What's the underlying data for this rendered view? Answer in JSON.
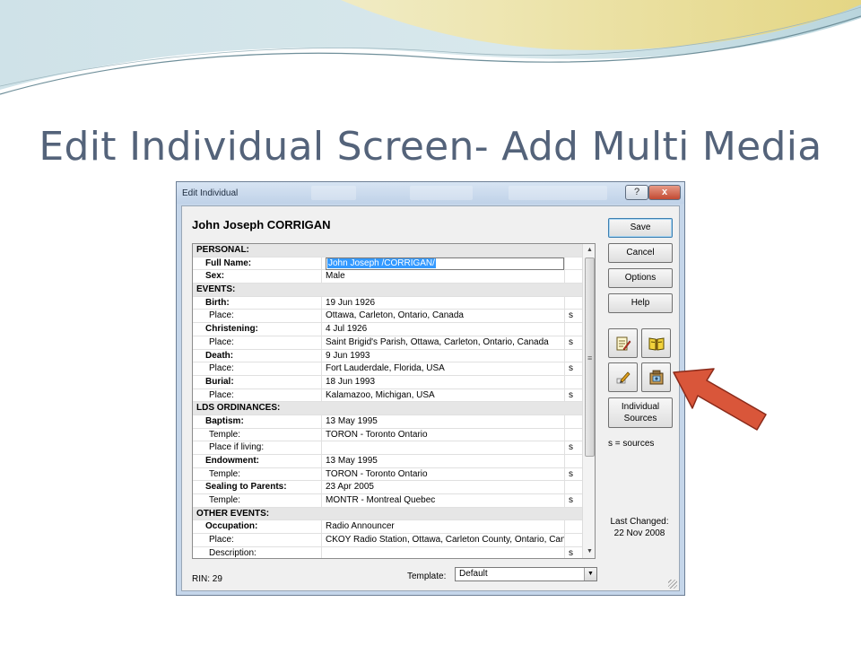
{
  "slide": {
    "title": "Edit Individual Screen- Add Multi Media"
  },
  "window": {
    "title": "Edit Individual",
    "help_glyph": "?",
    "close_glyph": "x"
  },
  "individual": {
    "name": "John Joseph CORRIGAN"
  },
  "grid": {
    "rows": [
      {
        "type": "section",
        "label": "PERSONAL:",
        "value": "",
        "source": ""
      },
      {
        "type": "event",
        "label": "Full Name:",
        "value": "John Joseph /CORRIGAN/",
        "source": "",
        "editing": true
      },
      {
        "type": "event",
        "label": "Sex:",
        "value": "Male",
        "source": ""
      },
      {
        "type": "section",
        "label": "EVENTS:",
        "value": "",
        "source": ""
      },
      {
        "type": "event",
        "label": "Birth:",
        "value": "19 Jun 1926",
        "source": ""
      },
      {
        "type": "sub",
        "label": "Place:",
        "value": "Ottawa, Carleton, Ontario, Canada",
        "source": "s"
      },
      {
        "type": "event",
        "label": "Christening:",
        "value": "4 Jul 1926",
        "source": ""
      },
      {
        "type": "sub",
        "label": "Place:",
        "value": "Saint Brigid's Parish, Ottawa, Carleton, Ontario, Canada",
        "source": "s"
      },
      {
        "type": "event",
        "label": "Death:",
        "value": "9 Jun 1993",
        "source": ""
      },
      {
        "type": "sub",
        "label": "Place:",
        "value": "Fort Lauderdale, Florida, USA",
        "source": "s"
      },
      {
        "type": "event",
        "label": "Burial:",
        "value": "18 Jun 1993",
        "source": ""
      },
      {
        "type": "sub",
        "label": "Place:",
        "value": "Kalamazoo, Michigan, USA",
        "source": "s"
      },
      {
        "type": "section",
        "label": "LDS ORDINANCES:",
        "value": "",
        "source": ""
      },
      {
        "type": "event",
        "label": "Baptism:",
        "value": "13 May 1995",
        "source": ""
      },
      {
        "type": "sub",
        "label": "Temple:",
        "value": "TORON - Toronto Ontario",
        "source": ""
      },
      {
        "type": "sub",
        "label": "Place if living:",
        "value": "",
        "source": "s"
      },
      {
        "type": "event",
        "label": "Endowment:",
        "value": "13 May 1995",
        "source": ""
      },
      {
        "type": "sub",
        "label": "Temple:",
        "value": "TORON - Toronto Ontario",
        "source": "s"
      },
      {
        "type": "event",
        "label": "Sealing to Parents:",
        "value": "23 Apr 2005",
        "source": ""
      },
      {
        "type": "sub",
        "label": "Temple:",
        "value": "MONTR - Montreal Quebec",
        "source": "s"
      },
      {
        "type": "section",
        "label": "OTHER EVENTS:",
        "value": "",
        "source": ""
      },
      {
        "type": "event",
        "label": "Occupation:",
        "value": "Radio Announcer",
        "source": ""
      },
      {
        "type": "sub",
        "label": "Place:",
        "value": "CKOY Radio Station, Ottawa, Carleton County, Ontario, Canada",
        "source": ""
      },
      {
        "type": "sub",
        "label": "Description:",
        "value": "",
        "source": "s"
      }
    ]
  },
  "buttons": {
    "save": "Save",
    "cancel": "Cancel",
    "options": "Options",
    "help": "Help",
    "individual_sources_line1": "Individual",
    "individual_sources_line2": "Sources"
  },
  "icons": {
    "notes": "notes-edit-icon",
    "book": "book-icon",
    "edit": "pencil-icon",
    "multimedia": "multimedia-icon"
  },
  "legend": {
    "sources": "s = sources"
  },
  "last_changed": {
    "label": "Last Changed:",
    "date": "22 Nov 2008"
  },
  "footer": {
    "rin": "RIN: 29",
    "template_label": "Template:",
    "template_value": "Default"
  },
  "colors": {
    "title": "#54637a",
    "arrow": "#d9563a",
    "selection": "#3399ff"
  }
}
